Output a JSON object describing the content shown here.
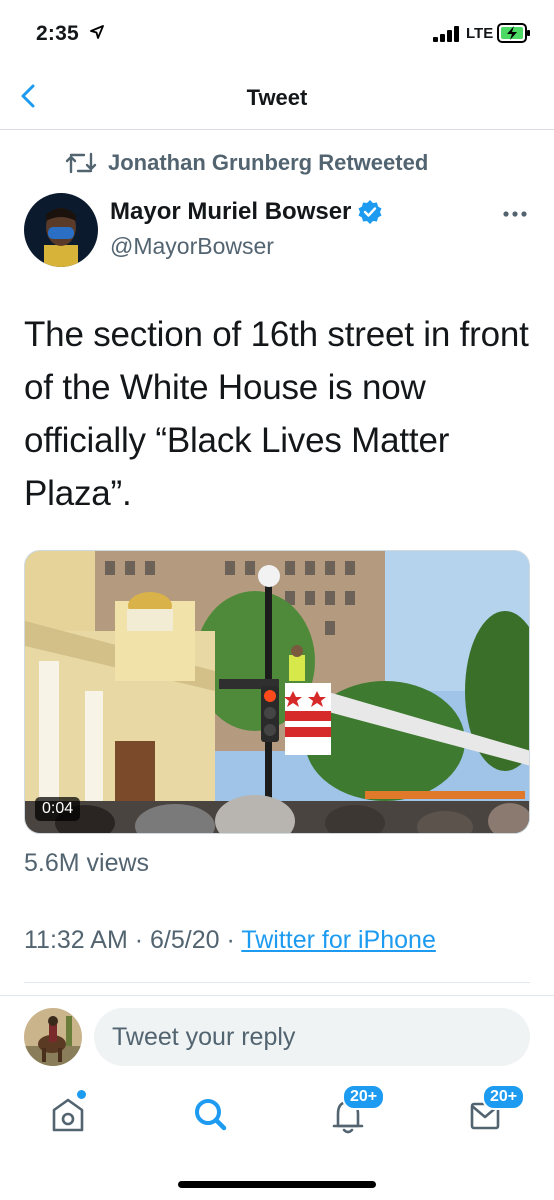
{
  "status_bar": {
    "time": "2:35",
    "network": "LTE"
  },
  "header": {
    "title": "Tweet",
    "back_icon": "chevron-left-icon"
  },
  "tweet": {
    "retweet_context": "Jonathan Grunberg Retweeted",
    "author": {
      "name": "Mayor Muriel Bowser",
      "handle": "@MayorBowser",
      "verified": true
    },
    "text": "The section of 16th street in front of the White House is now officially “Black Lives Matter Plaza”.",
    "media": {
      "type": "video",
      "duration": "0:04"
    },
    "views": "5.6M views",
    "time": "11:32 AM",
    "date": "6/5/20",
    "separator": "·",
    "source": "Twitter for iPhone"
  },
  "reply": {
    "placeholder": "Tweet your reply"
  },
  "tab_bar": {
    "items": [
      {
        "name": "home",
        "icon": "home-icon",
        "badge": ""
      },
      {
        "name": "search",
        "icon": "search-icon",
        "badge": ""
      },
      {
        "name": "notifications",
        "icon": "bell-icon",
        "badge": "20+"
      },
      {
        "name": "messages",
        "icon": "mail-icon",
        "badge": "20+"
      }
    ]
  },
  "colors": {
    "accent": "#1d9bf0",
    "secondary_text": "#536471",
    "primary_text": "#14171a"
  }
}
